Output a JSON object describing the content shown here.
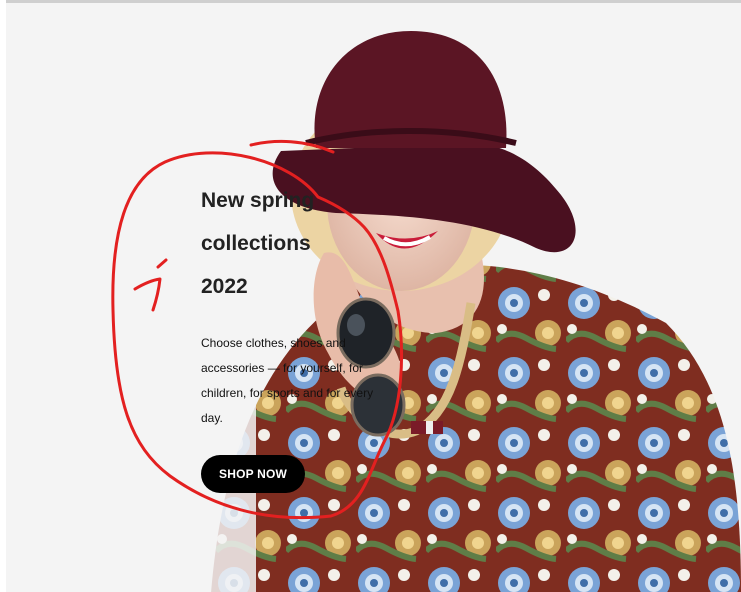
{
  "hero": {
    "title_lines": [
      "New spring",
      "collections",
      "2022"
    ],
    "description": "Choose clothes, shoes and accessories — for yourself, for children, for sports and for every day.",
    "cta_label": "SHOP NOW"
  },
  "annotation": {
    "marker_label": "1",
    "color": "#e32020"
  },
  "colors": {
    "hat": "#5b1524",
    "hair": "#f1d9a4",
    "shirt": "#7f2d20",
    "flowers": "#7aa3d6",
    "button": "#000000"
  },
  "icons": [
    "sunglasses-icon"
  ]
}
